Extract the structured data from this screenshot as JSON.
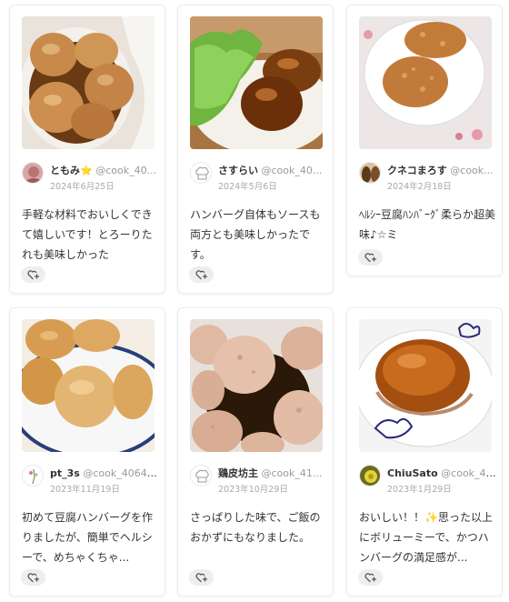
{
  "cards": [
    {
      "user": "ともみ⭐",
      "id": "@cook_40...",
      "date": "2024年6月25日",
      "comment": "手軽な材料でおいしくできて嬉しいです！とろーりたれも美味しかった",
      "icons": {
        "avatar": "user-photo-avatar",
        "like": "heart-plus-icon"
      }
    },
    {
      "user": "さすらい",
      "id": "@cook_40...",
      "date": "2024年5月6日",
      "comment": "ハンバーグ自体もソースも両方とも美味しかったです。",
      "icons": {
        "avatar": "chef-hat-avatar",
        "like": "heart-plus-icon"
      }
    },
    {
      "user": "クネコまろす",
      "id": "@cook...",
      "date": "2024年2月18日",
      "comment": "ﾍﾙｼｰ豆腐ﾊﾝﾊﾞｰｸﾞ柔らか超美味♪☆ミ",
      "icons": {
        "avatar": "user-photo-avatar",
        "like": "heart-plus-icon"
      }
    },
    {
      "user": "pt_3s",
      "id": "@cook_40641...",
      "date": "2023年11月19日",
      "comment": "初めて豆腐ハンバーグを作りましたが、簡単でヘルシーで、めちゃくちゃ...",
      "icons": {
        "avatar": "user-photo-avatar",
        "like": "heart-plus-icon"
      }
    },
    {
      "user": "鶏皮坊主",
      "id": "@cook_41...",
      "date": "2023年10月29日",
      "comment": "さっぱりした味で、ご飯のおかずにもなりました。",
      "icons": {
        "avatar": "chef-hat-avatar",
        "like": "heart-plus-icon"
      }
    },
    {
      "user": "ChiuSato",
      "id": "@cook_40...",
      "date": "2023年1月29日",
      "comment": "おいしい！！✨思った以上にボリューミーで、かつハンバーグの満足感が...",
      "icons": {
        "avatar": "user-photo-avatar",
        "like": "heart-plus-icon"
      }
    }
  ],
  "colors": {
    "card_border": "#ececec",
    "text": "#333333",
    "muted": "#999999",
    "date": "#a9a9a9",
    "like_bg": "#eeeeee"
  }
}
